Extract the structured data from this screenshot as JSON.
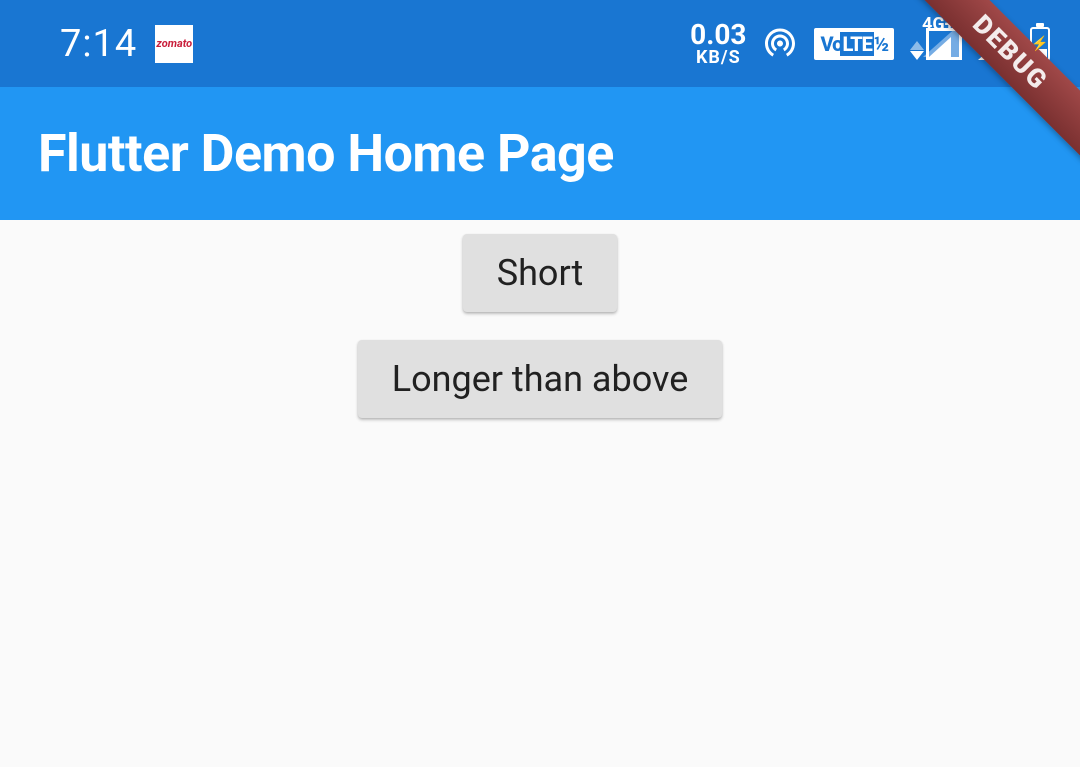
{
  "status_bar": {
    "time": "7:14",
    "zomato_label": "zomato",
    "net_speed_value": "0.03",
    "net_speed_unit": "KB/S",
    "volte_label": "VoLTE",
    "signal_label": "4G+"
  },
  "app_bar": {
    "title": "Flutter Demo Home Page"
  },
  "buttons": {
    "short": "Short",
    "longer": "Longer than above"
  },
  "debug": {
    "label": "DEBUG"
  }
}
